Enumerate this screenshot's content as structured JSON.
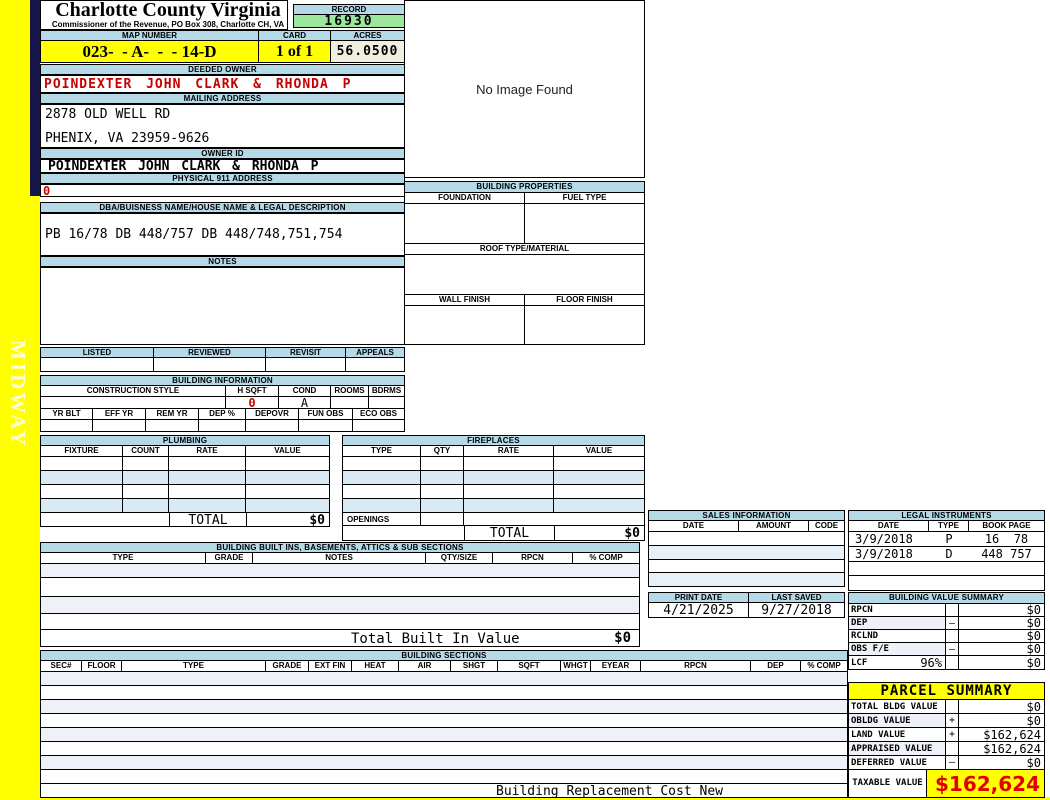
{
  "colors": {
    "header_blue": "#b6d9e7",
    "record_green": "#9de69d",
    "highlight_yellow": "#ffff00",
    "acres_cream": "#f0efde",
    "alert_red": "#c80000",
    "navy_strip": "#16164a"
  },
  "sidebar": {
    "watermark": "MIDWAY"
  },
  "header": {
    "title": "Charlotte County Virginia",
    "subtitle": "Commissioner of the Revenue, PO Box 308, Charlotte CH, VA",
    "record_label": "RECORD",
    "record_value": "16930",
    "map_number_label": "MAP NUMBER",
    "map_number": "023-  - A-  -  - 14-D",
    "card_label": "CARD",
    "card_value": "1 of 1",
    "acres_label": "ACRES",
    "acres_value": "56.0500"
  },
  "owner": {
    "deeded_owner_label": "DEEDED OWNER",
    "deeded_owner": "POINDEXTER JOHN CLARK & RHONDA P",
    "mailing_label": "MAILING ADDRESS",
    "mailing_line1": "2878 OLD WELL RD",
    "mailing_line2": "PHENIX, VA 23959-9626",
    "owner_id_label": "OWNER ID",
    "owner_id": "POINDEXTER JOHN CLARK & RHONDA P",
    "physical_label": "PHYSICAL 911 ADDRESS",
    "physical_value": "0"
  },
  "legal": {
    "dba_label": "DBA/BUISNESS NAME/HOUSE NAME & LEGAL DESCRIPTION",
    "description": "PB 16/78 DB 448/757 DB 448/748,751,754",
    "notes_label": "NOTES"
  },
  "review": {
    "headers": [
      "LISTED",
      "REVIEWED",
      "REVISIT",
      "APPEALS"
    ]
  },
  "building_info": {
    "title": "BUILDING INFORMATION",
    "row1_headers": [
      "CONSTRUCTION STYLE",
      "H SQFT",
      "COND",
      "ROOMS",
      "BDRMS"
    ],
    "h_sqft": "0",
    "cond": "A",
    "row2_headers": [
      "YR BLT",
      "EFF YR",
      "REM YR",
      "DEP %",
      "DEPOVR",
      "FUN OBS",
      "ECO OBS"
    ]
  },
  "plumbing": {
    "title": "PLUMBING",
    "headers": [
      "FIXTURE",
      "COUNT",
      "RATE",
      "VALUE"
    ],
    "total_label": "TOTAL",
    "total_value": "$0"
  },
  "fireplaces": {
    "title": "FIREPLACES",
    "headers": [
      "TYPE",
      "QTY",
      "RATE",
      "VALUE"
    ],
    "openings_label": "OPENINGS",
    "total_label": "TOTAL",
    "total_value": "$0"
  },
  "built_ins": {
    "title": "BUILDING BUILT INS, BASEMENTS, ATTICS & SUB SECTIONS",
    "headers": [
      "TYPE",
      "GRADE",
      "NOTES",
      "QTY/SIZE",
      "RPCN",
      "% COMP"
    ],
    "total_label": "Total Built In Value",
    "total_value": "$0"
  },
  "building_sections": {
    "title": "BUILDING SECTIONS",
    "headers": [
      "SEC#",
      "FLOOR",
      "TYPE",
      "GRADE",
      "EXT FIN",
      "HEAT",
      "AIR",
      "SHGT",
      "SQFT",
      "WHGT",
      "EYEAR",
      "RPCN",
      "DEP",
      "% COMP"
    ],
    "footer_note": "Building Replacement Cost New"
  },
  "sales": {
    "title": "SALES INFORMATION",
    "headers": [
      "DATE",
      "AMOUNT",
      "CODE"
    ]
  },
  "legal_instruments": {
    "title": "LEGAL INSTRUMENTS",
    "headers": [
      "DATE",
      "TYPE",
      "BOOK PAGE"
    ],
    "rows": [
      {
        "date": "3/9/2018",
        "type": "P",
        "book_page": "16  78"
      },
      {
        "date": "3/9/2018",
        "type": "D",
        "book_page": "448 757"
      }
    ]
  },
  "print_info": {
    "print_date_label": "PRINT DATE",
    "print_date": "4/21/2025",
    "last_saved_label": "LAST SAVED",
    "last_saved": "9/27/2018"
  },
  "building_value_summary": {
    "title": "BUILDING VALUE SUMMARY",
    "rows": [
      {
        "label": "RPCN",
        "extra": "",
        "op": "",
        "value": "$0"
      },
      {
        "label": "DEP",
        "extra": "",
        "op": "—",
        "value": "$0"
      },
      {
        "label": "RCLND",
        "extra": "",
        "op": "",
        "value": "$0"
      },
      {
        "label": "OBS F/E",
        "extra": "",
        "op": "—",
        "value": "$0"
      },
      {
        "label": "LCF",
        "extra": "96%",
        "op": "",
        "value": "$0"
      }
    ]
  },
  "parcel_summary": {
    "title": "PARCEL SUMMARY",
    "rows": [
      {
        "label": "TOTAL BLDG VALUE",
        "op": "",
        "value": "$0"
      },
      {
        "label": "OBLDG VALUE",
        "op": "+",
        "value": "$0"
      },
      {
        "label": "LAND VALUE",
        "op": "+",
        "value": "$162,624"
      },
      {
        "label": "APPRAISED VALUE",
        "op": "",
        "value": "$162,624"
      },
      {
        "label": "DEFERRED VALUE",
        "op": "—",
        "value": "$0"
      }
    ],
    "taxable_label": "TAXABLE VALUE",
    "taxable_value": "$162,624"
  },
  "image_panel": {
    "placeholder": "No Image Found"
  },
  "building_properties": {
    "title": "BUILDING PROPERTIES",
    "foundation_label": "FOUNDATION",
    "fuel_label": "FUEL TYPE",
    "roof_label": "ROOF TYPE/MATERIAL",
    "wall_label": "WALL FINISH",
    "floor_label": "FLOOR FINISH"
  }
}
